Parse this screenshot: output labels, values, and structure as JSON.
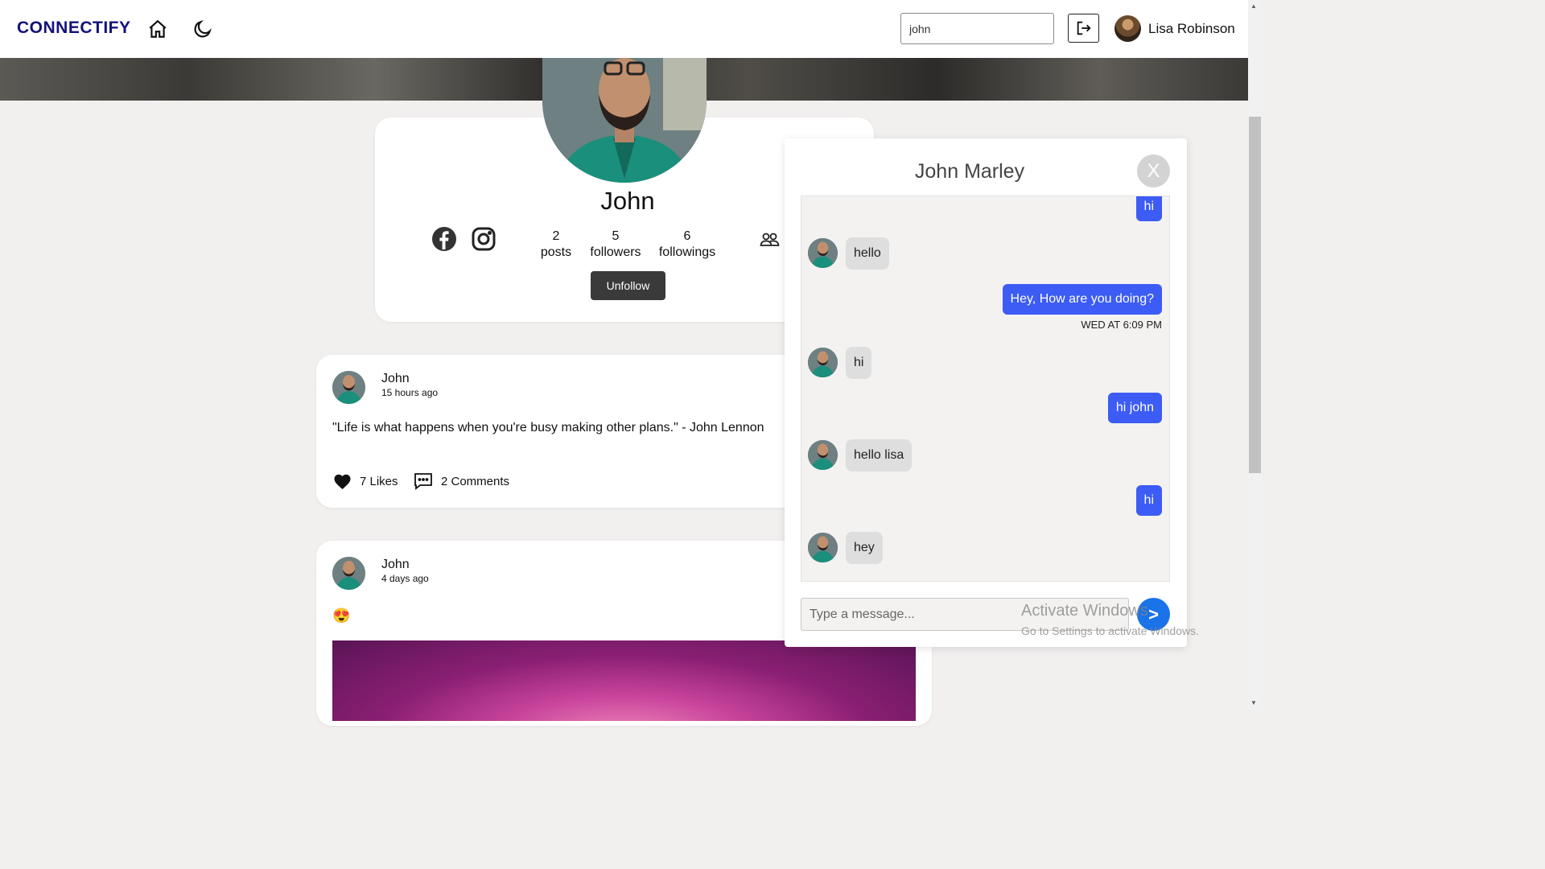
{
  "navbar": {
    "brand": "CONNECTIFY",
    "search_value": "john",
    "user_name": "Lisa Robinson",
    "icons": [
      "home-icon",
      "moon-icon",
      "logout-icon"
    ]
  },
  "profile": {
    "name": "John",
    "stats": [
      {
        "value": "2",
        "label": "posts"
      },
      {
        "value": "5",
        "label": "followers"
      },
      {
        "value": "6",
        "label": "followings"
      }
    ],
    "unfollow_label": "Unfollow",
    "icons": [
      "facebook-icon",
      "instagram-icon",
      "users-icon"
    ]
  },
  "posts": [
    {
      "author": "John",
      "time": "15 hours ago",
      "text": "\"Life is what happens when you're busy making other plans.\" - John Lennon",
      "likes": "7 Likes",
      "comments": "2 Comments"
    },
    {
      "author": "John",
      "time": "4 days ago",
      "text": "😍"
    }
  ],
  "chat": {
    "title": "John Marley",
    "close_label": "X",
    "messages": [
      {
        "from": "me",
        "text": "hi"
      },
      {
        "from": "them",
        "text": "hello"
      },
      {
        "from": "me",
        "text": "Hey, How are you doing?",
        "time": "WED AT 6:09 PM"
      },
      {
        "from": "them",
        "text": "hi"
      },
      {
        "from": "me",
        "text": "hi john"
      },
      {
        "from": "them",
        "text": "hello lisa"
      },
      {
        "from": "me",
        "text": "hi"
      },
      {
        "from": "them",
        "text": "hey"
      }
    ],
    "input_placeholder": "Type a message...",
    "send_label": ">"
  },
  "watermark": {
    "line1": "Activate Windows",
    "line2": "Go to Settings to activate Windows."
  },
  "colors": {
    "brand": "#12127a",
    "bubble_out": "#3c5cf5",
    "send": "#1a73e8"
  }
}
